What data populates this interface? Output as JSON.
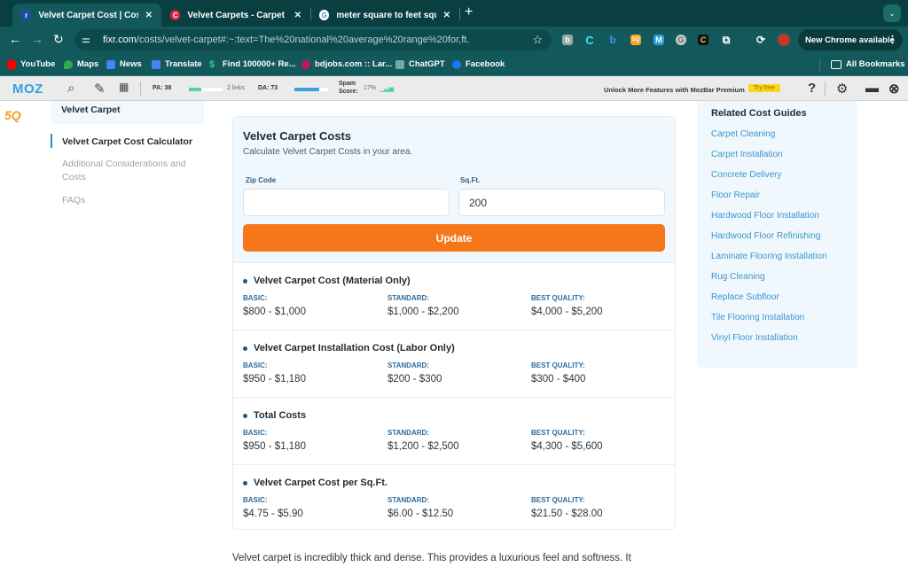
{
  "browser": {
    "tabs": [
      {
        "title": "Velvet Carpet Cost | Cost to I",
        "favicon": "fixr-icon",
        "active": true
      },
      {
        "title": "Velvet Carpets - Carpet GIAN",
        "favicon": "carpet-giant-icon",
        "active": false
      },
      {
        "title": "meter square to feet square",
        "favicon": "google-icon",
        "active": false
      }
    ],
    "new_tab_symbol": "+",
    "tab_menu_symbol": "⌄",
    "url_host": "fixr.com",
    "url_path": "/costs/velvet-carpet#:~:text=The%20national%20average%20range%20for,ft.",
    "new_chrome_label": "New Chrome available",
    "bookmarks": [
      {
        "label": "YouTube",
        "color": "#ff0000"
      },
      {
        "label": "Maps",
        "color": "#34a853"
      },
      {
        "label": "News",
        "color": "#4285f4"
      },
      {
        "label": "Translate",
        "color": "#4285f4"
      },
      {
        "label": "Find 100000+ Re...",
        "color": "#2ecc71"
      },
      {
        "label": "bdjobs.com :: Lar...",
        "color": "#c2185b"
      },
      {
        "label": "ChatGPT",
        "color": "#74aa9c"
      },
      {
        "label": "Facebook",
        "color": "#1877f2"
      }
    ],
    "all_bookmarks_label": "All Bookmarks"
  },
  "mozbar": {
    "logo": "MOZ",
    "pa_label": "PA: 38",
    "pa_score": 38,
    "links_label": "2 links",
    "da_label": "DA: 73",
    "da_score": 73,
    "spam_label_1": "Spam",
    "spam_label_2": "Score:",
    "spam_value": "17%",
    "unlock_text": "Unlock More Features with MozBar Premium",
    "try_free": "Try free",
    "help": "?",
    "colors": {
      "pa_bar": "#4fd1b5",
      "da_bar": "#3ba2dc",
      "try_free_bg": "#f9d71c"
    }
  },
  "sidebar": {
    "logo_text": "5Q",
    "toc_heading": "Velvet Carpet",
    "items": [
      {
        "label": "Velvet Carpet Cost Calculator",
        "active": true
      },
      {
        "label": "Additional Considerations and Costs",
        "active": false
      },
      {
        "label": "FAQs",
        "active": false
      }
    ]
  },
  "calculator": {
    "title": "Velvet Carpet Costs",
    "subtitle": "Calculate Velvet Carpet Costs in your area.",
    "zip_label": "Zip Code",
    "zip_value": "",
    "sqft_label": "Sq.Ft.",
    "sqft_value": "200",
    "update_label": "Update",
    "accent_color": "#f57719",
    "sections": [
      {
        "title": "Velvet Carpet Cost (Material Only)",
        "tiers": [
          {
            "label": "BASIC:",
            "value": "$800 - $1,000"
          },
          {
            "label": "STANDARD:",
            "value": "$1,000 - $2,200"
          },
          {
            "label": "BEST QUALITY:",
            "value": "$4,000 - $5,200"
          }
        ]
      },
      {
        "title": "Velvet Carpet Installation Cost (Labor Only)",
        "tiers": [
          {
            "label": "BASIC:",
            "value": "$950 - $1,180"
          },
          {
            "label": "STANDARD:",
            "value": "$200 - $300"
          },
          {
            "label": "BEST QUALITY:",
            "value": "$300 - $400"
          }
        ]
      },
      {
        "title": "Total Costs",
        "tiers": [
          {
            "label": "BASIC:",
            "value": "$950 - $1,180"
          },
          {
            "label": "STANDARD:",
            "value": "$1,200 - $2,500"
          },
          {
            "label": "BEST QUALITY:",
            "value": "$4,300 - $5,600"
          }
        ]
      },
      {
        "title": "Velvet Carpet Cost per Sq.Ft.",
        "tiers": [
          {
            "label": "BASIC:",
            "value": "$4.75 - $5.90"
          },
          {
            "label": "STANDARD:",
            "value": "$6.00 - $12.50"
          },
          {
            "label": "BEST QUALITY:",
            "value": "$21.50 - $28.00"
          }
        ]
      }
    ]
  },
  "related": {
    "title": "Related Cost Guides",
    "links": [
      "Carpet Cleaning",
      "Carpet Installation",
      "Concrete Delivery",
      "Floor Repair",
      "Hardwood Floor Installation",
      "Hardwood Floor Refinishing",
      "Laminate Flooring Installation",
      "Rug Cleaning",
      "Replace Subfloor",
      "Tile Flooring Installation",
      "Vinyl Floor Installation"
    ]
  },
  "body_text": "Velvet carpet is incredibly thick and dense. This provides a luxurious feel and softness. It"
}
